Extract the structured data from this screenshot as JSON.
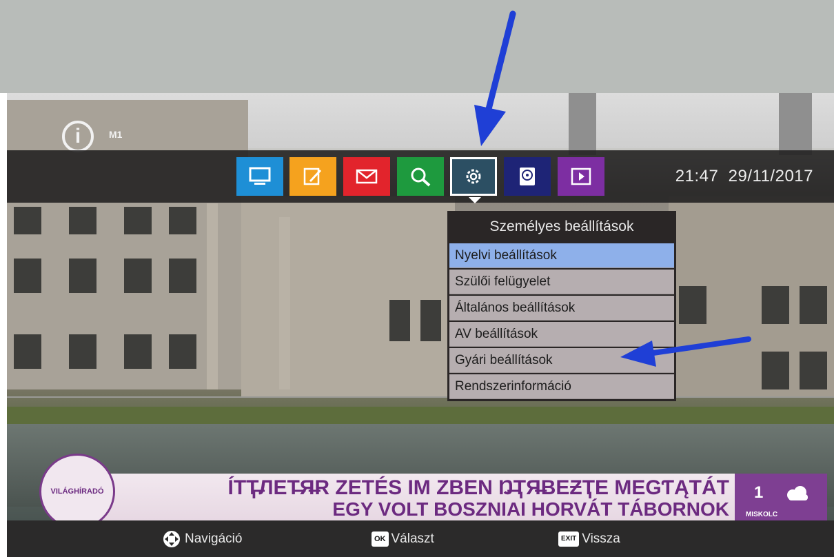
{
  "channel": {
    "name": "M1",
    "logo": "i"
  },
  "menu_bar": {
    "tiles": [
      {
        "icon": "tv-icon",
        "color": "#1e8fd6"
      },
      {
        "icon": "edit-icon",
        "color": "#f5a21e"
      },
      {
        "icon": "mail-icon",
        "color": "#e2242c"
      },
      {
        "icon": "search-icon",
        "color": "#1e9a3e"
      },
      {
        "icon": "gear-icon",
        "color": "#2c4f63",
        "selected": true
      },
      {
        "icon": "hdd-icon",
        "color": "#1e2476"
      },
      {
        "icon": "play-icon",
        "color": "#7d2ea2"
      }
    ],
    "time": "21:47",
    "date": "29/11/2017"
  },
  "submenu": {
    "title": "Személyes beállítások",
    "items": [
      {
        "label": "Nyelvi beállítások",
        "active": true
      },
      {
        "label": "Szülői felügyelet"
      },
      {
        "label": "Általános beállítások"
      },
      {
        "label": "AV beállítások"
      },
      {
        "label": "Gyári beállítások"
      },
      {
        "label": "Rendszerinformáció"
      }
    ]
  },
  "ticker": {
    "badge": "VILÁGHÍRADÓ",
    "line1": "ÍTҬ̶ЛЕТ̶Я̶R ZETÉS IM ZBEN Ŋ̶ҬЯ̶BEƵҬE MEGƬĄTÁT",
    "line2": "EGY VOLT BOSZNIAI HORVÁT TÁBORNOK",
    "weather_temp": "1",
    "weather_city": "MISKOLC"
  },
  "hints": {
    "nav_label": "Navigáció",
    "ok_key": "OK",
    "ok_label": "Választ",
    "exit_key": "EXIT",
    "exit_label": "Vissza"
  },
  "colors": {
    "annotation_arrow": "#1f3fd6",
    "active_item": "#8eb0ea"
  }
}
